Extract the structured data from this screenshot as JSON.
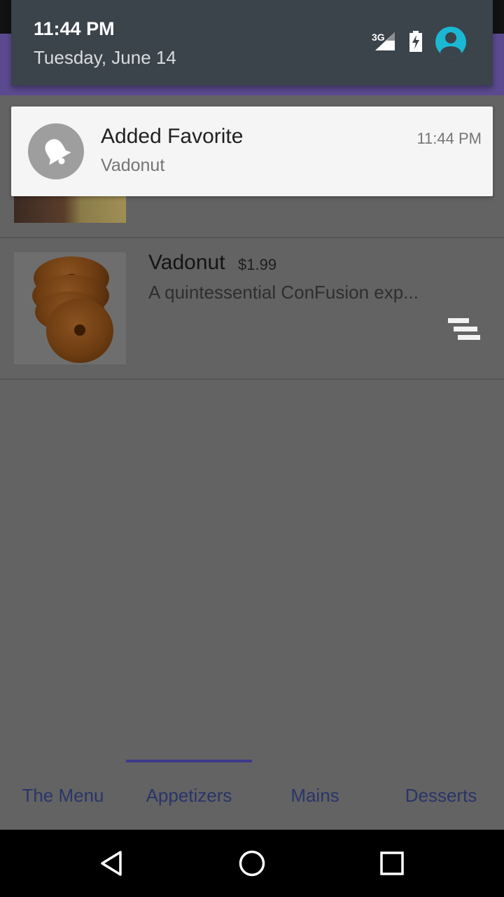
{
  "notification_shade": {
    "time": "11:44 PM",
    "date": "Tuesday, June 14",
    "network": "3G",
    "colors": {
      "shade_bg": "#3b434b",
      "avatar": "#1ab8d2"
    }
  },
  "notification": {
    "title": "Added Favorite",
    "text": "Vadonut",
    "time": "11:44 PM",
    "icon": "bell-icon"
  },
  "menu": {
    "items": [
      {
        "name": "Vadonut",
        "price": "$1.99",
        "description": "A quintessential ConFusion exp..."
      }
    ]
  },
  "tabs": {
    "items": [
      "The Menu",
      "Appetizers",
      "Mains",
      "Desserts"
    ],
    "selected": "Appetizers",
    "colors": {
      "label": "#2a3568",
      "indicator": "#3e3a8a"
    }
  },
  "system_nav": {
    "buttons": [
      "back-icon",
      "home-icon",
      "recents-icon"
    ]
  },
  "colors": {
    "toolbar": "#5b4a90",
    "scrim_background": "#626262"
  }
}
